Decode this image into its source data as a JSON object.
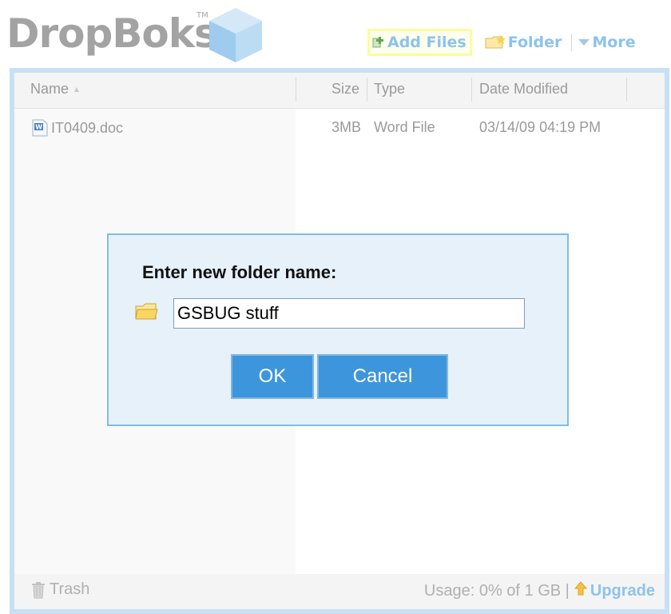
{
  "app": {
    "title": "DropBoks",
    "tm": "TM"
  },
  "toolbar": {
    "add_files": "Add Files",
    "folder": "Folder",
    "more": "More"
  },
  "columns": {
    "name": "Name",
    "size": "Size",
    "type": "Type",
    "date": "Date Modified"
  },
  "files": [
    {
      "name": "IT0409.doc",
      "size": "3MB",
      "type": "Word File",
      "date": "03/14/09 04:19 PM",
      "icon": "word-doc-icon"
    }
  ],
  "footer": {
    "trash": "Trash",
    "usage": "Usage: 0% of 1 GB |",
    "upgrade": "Upgrade"
  },
  "dialog": {
    "title": "Enter new folder name:",
    "input_value": "GSBUG stuff",
    "ok": "OK",
    "cancel": "Cancel"
  },
  "colors": {
    "accent": "#8cc3ec",
    "button": "#3d96db",
    "panel_border": "#c6e0f5",
    "dialog_bg": "#e6f1fa"
  }
}
